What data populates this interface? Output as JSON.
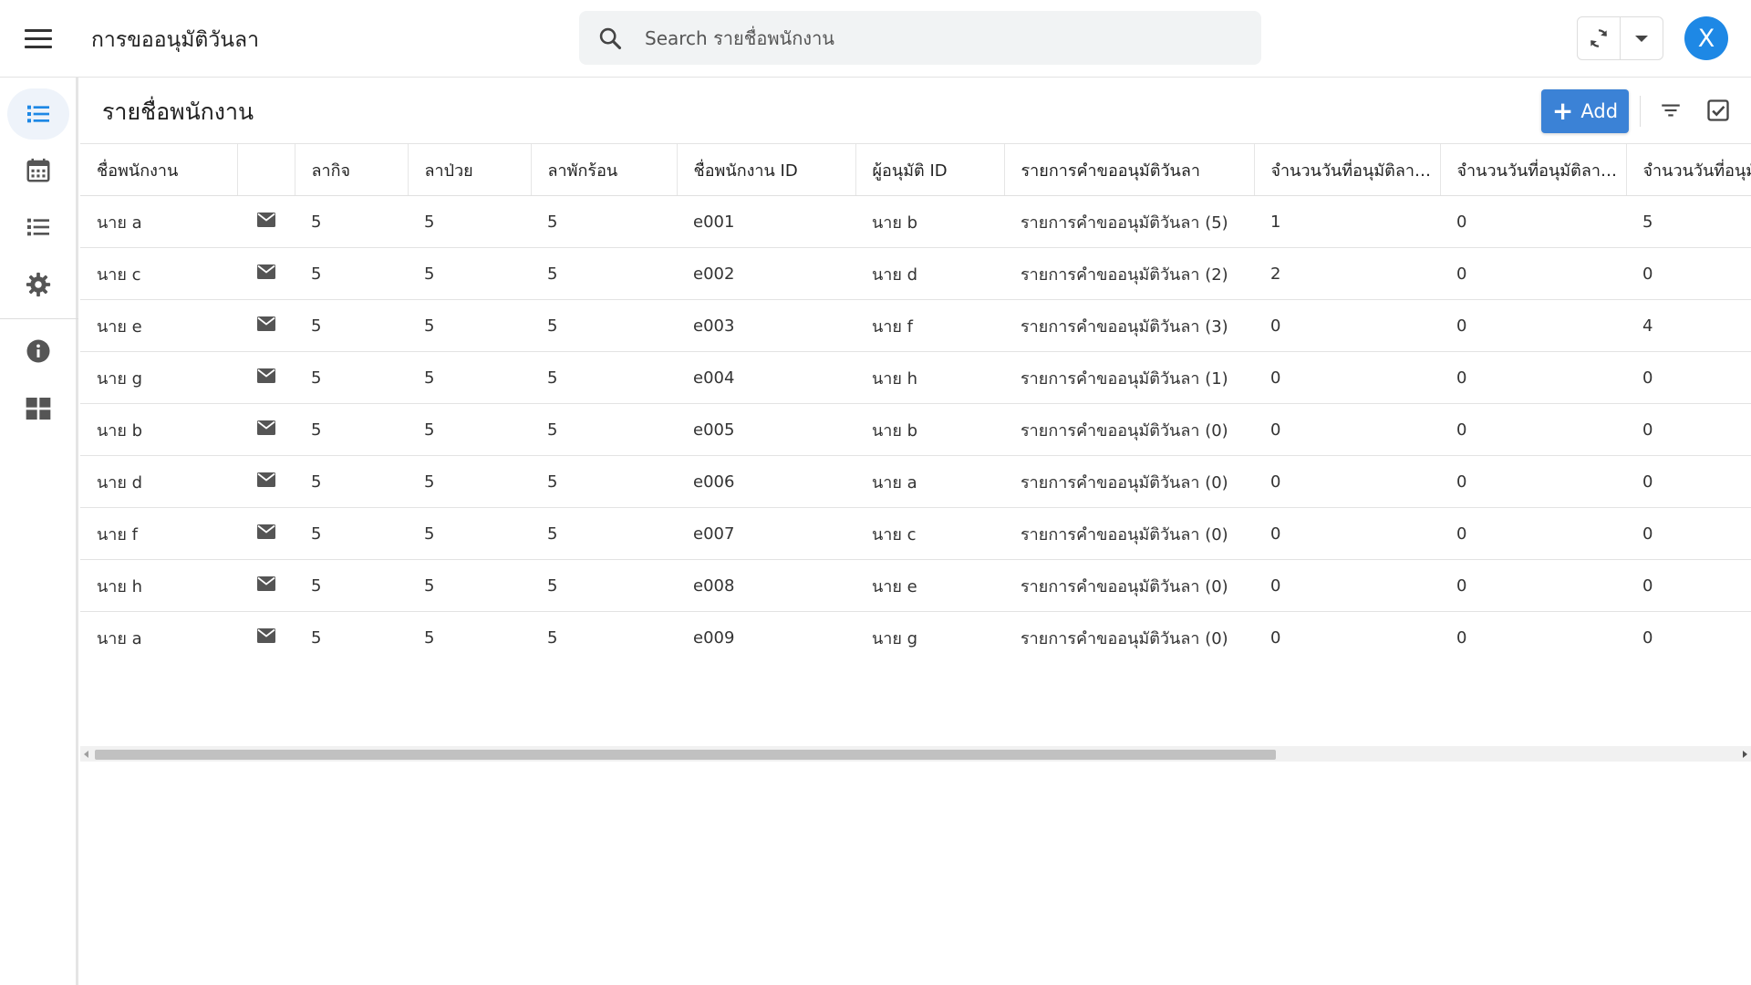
{
  "app": {
    "title": "การขออนุมัติวันลา",
    "avatar_letter": "X"
  },
  "search": {
    "placeholder": "Search รายชื่อพนักงาน",
    "value": ""
  },
  "page": {
    "title": "รายชื่อพนักงาน",
    "add_label": "Add"
  },
  "sidebar": {
    "items": [
      {
        "name": "list-view-icon",
        "active": true
      },
      {
        "name": "calendar-icon",
        "active": false
      },
      {
        "name": "list-icon",
        "active": false
      },
      {
        "name": "gear-icon",
        "active": false
      },
      {
        "name": "info-icon",
        "active": false
      },
      {
        "name": "dashboard-icon",
        "active": false
      }
    ]
  },
  "table": {
    "columns": [
      "ชื่อพนักงาน",
      "",
      "ลากิจ",
      "ลาป่วย",
      "ลาพักร้อน",
      "ชื่อพนักงาน ID",
      "ผู้อนุมัติ ID",
      "รายการคำขออนุมัติวันลา",
      "จำนวนวันที่อนุมัติลากิ...",
      "จำนวนวันที่อนุมัติลาป่...",
      "จำนวนวันที่อนุมั"
    ],
    "rows": [
      [
        "นาย a",
        "5",
        "5",
        "5",
        "e001",
        "นาย b",
        "รายการคำขออนุมัติวันลา (5)",
        "1",
        "0",
        "5"
      ],
      [
        "นาย c",
        "5",
        "5",
        "5",
        "e002",
        "นาย d",
        "รายการคำขออนุมัติวันลา (2)",
        "2",
        "0",
        "0"
      ],
      [
        "นาย e",
        "5",
        "5",
        "5",
        "e003",
        "นาย f",
        "รายการคำขออนุมัติวันลา (3)",
        "0",
        "0",
        "4"
      ],
      [
        "นาย g",
        "5",
        "5",
        "5",
        "e004",
        "นาย h",
        "รายการคำขออนุมัติวันลา (1)",
        "0",
        "0",
        "0"
      ],
      [
        "นาย b",
        "5",
        "5",
        "5",
        "e005",
        "นาย b",
        "รายการคำขออนุมัติวันลา (0)",
        "0",
        "0",
        "0"
      ],
      [
        "นาย d",
        "5",
        "5",
        "5",
        "e006",
        "นาย a",
        "รายการคำขออนุมัติวันลา (0)",
        "0",
        "0",
        "0"
      ],
      [
        "นาย f",
        "5",
        "5",
        "5",
        "e007",
        "นาย c",
        "รายการคำขออนุมัติวันลา (0)",
        "0",
        "0",
        "0"
      ],
      [
        "นาย h",
        "5",
        "5",
        "5",
        "e008",
        "นาย e",
        "รายการคำขออนุมัติวันลา (0)",
        "0",
        "0",
        "0"
      ],
      [
        "นาย a",
        "5",
        "5",
        "5",
        "e009",
        "นาย g",
        "รายการคำขออนุมัติวันลา (0)",
        "0",
        "0",
        "0"
      ]
    ]
  },
  "colors": {
    "accent": "#3b82d6",
    "avatar": "#1e88e5",
    "active_nav": "#eef3fa"
  }
}
